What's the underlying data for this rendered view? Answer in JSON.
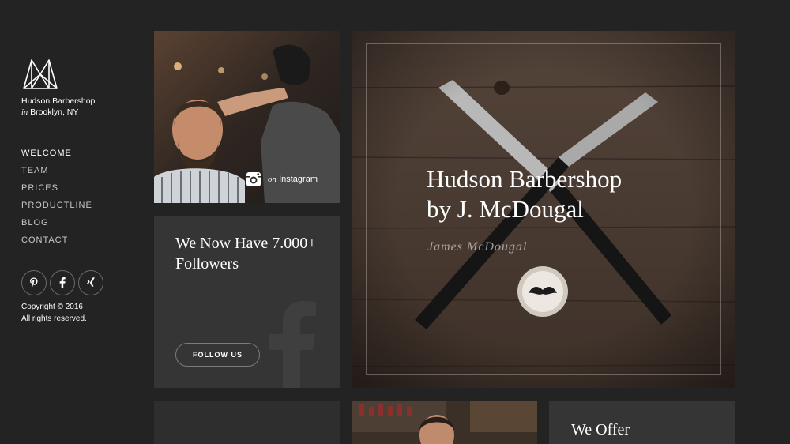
{
  "brand": {
    "name": "Hudson Barbershop",
    "location_prefix": "in",
    "location": "Brooklyn, NY"
  },
  "nav": {
    "items": [
      {
        "label": "WELCOME",
        "active": true
      },
      {
        "label": "TEAM",
        "active": false
      },
      {
        "label": "PRICES",
        "active": false
      },
      {
        "label": "PRODUCTLINE",
        "active": false
      },
      {
        "label": "BLOG",
        "active": false
      },
      {
        "label": "CONTACT",
        "active": false
      }
    ]
  },
  "socials": [
    {
      "name": "pinterest-icon"
    },
    {
      "name": "facebook-icon"
    },
    {
      "name": "xing-icon"
    }
  ],
  "footer": {
    "copyright": "Copyright © 2016",
    "rights": "All rights reserved."
  },
  "instagram": {
    "on": "on",
    "label": "Instagram"
  },
  "followers": {
    "heading": "We Now Have 7.000+ Followers",
    "button": "FOLLOW US"
  },
  "hero": {
    "title_line1": "Hudson Barbershop",
    "title_line2": "by J. McDougal",
    "signature": "James McDougal"
  },
  "offer": {
    "heading": "We Offer"
  },
  "colors": {
    "background": "#232323",
    "tile": "#353535",
    "accent": "#ffffff"
  }
}
